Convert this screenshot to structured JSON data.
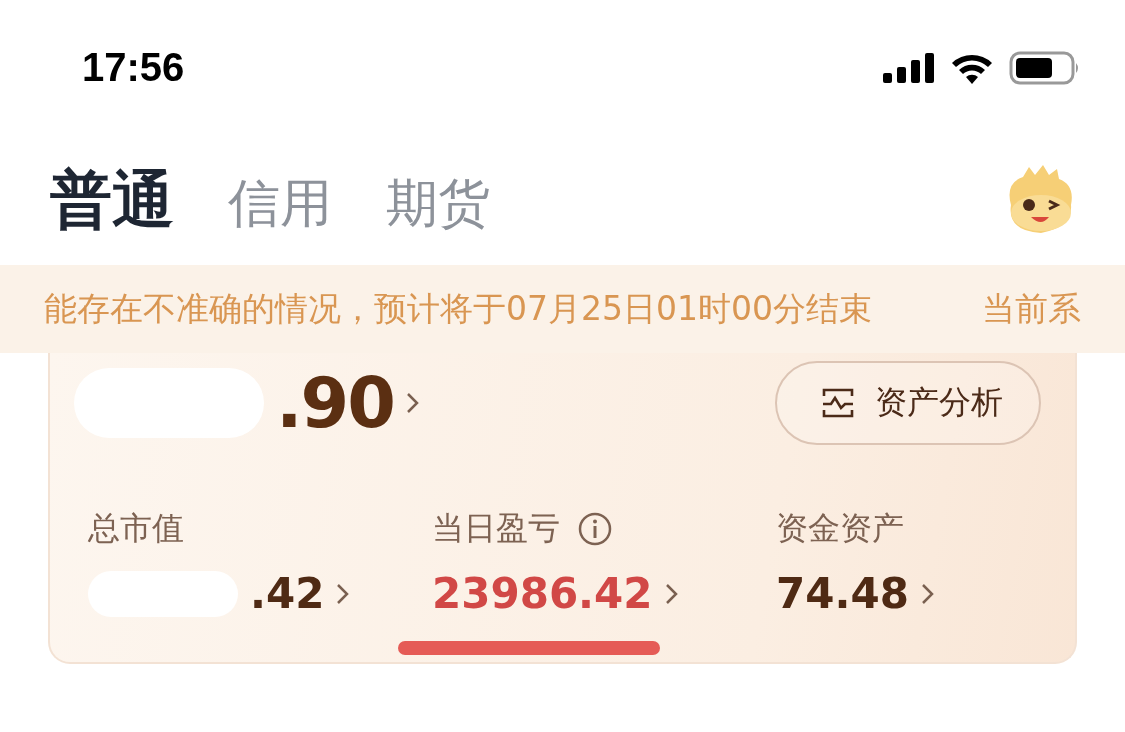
{
  "status_bar": {
    "time": "17:56"
  },
  "tabs": [
    {
      "label": "普通",
      "selected": true
    },
    {
      "label": "信用",
      "selected": false
    },
    {
      "label": "期货",
      "selected": false
    }
  ],
  "notice": {
    "segments": [
      "能存在不准确的情况，预计将于07月25日01时00分结束",
      "当前系"
    ]
  },
  "card": {
    "total_assets": ".90",
    "analysis_button": "资产分析",
    "stats": [
      {
        "label": "总市值",
        "value": ".42",
        "kind": "redacted",
        "info": false
      },
      {
        "label": "当日盈亏",
        "value": "23986.42",
        "kind": "profit",
        "info": true
      },
      {
        "label": "资金资产",
        "value": "74.48",
        "kind": "plain",
        "info": false
      }
    ]
  }
}
